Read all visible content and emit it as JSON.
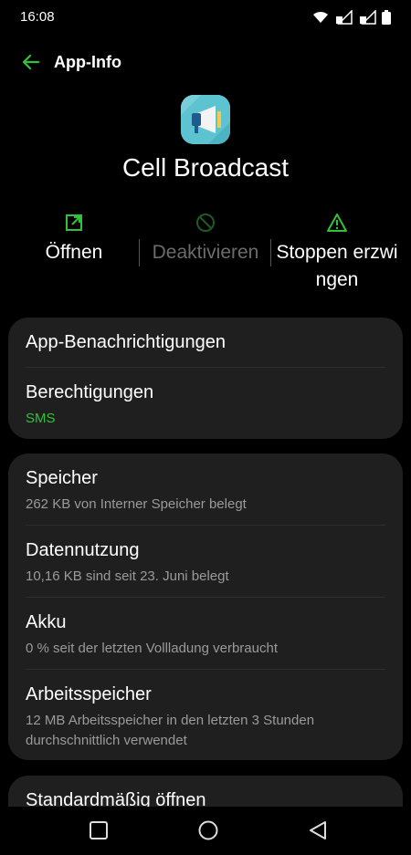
{
  "status": {
    "time": "16:08"
  },
  "appbar": {
    "title": "App-Info"
  },
  "app": {
    "name": "Cell Broadcast"
  },
  "actions": [
    {
      "label": "Öffnen",
      "enabled": true,
      "icon": "open-external-icon"
    },
    {
      "label": "Deaktivieren",
      "enabled": false,
      "icon": "disable-icon"
    },
    {
      "label": "Stoppen erzwingen",
      "enabled": true,
      "icon": "warning-icon"
    }
  ],
  "card1": {
    "notifications": {
      "title": "App-Benachrichtigungen"
    },
    "permissions": {
      "title": "Berechtigungen",
      "subtitle": "SMS"
    }
  },
  "card2": {
    "storage": {
      "title": "Speicher",
      "subtitle": "262 KB von Interner Speicher belegt"
    },
    "data": {
      "title": "Datennutzung",
      "subtitle": "10,16 KB sind seit 23. Juni belegt"
    },
    "battery": {
      "title": "Akku",
      "subtitle": "0 % seit der letzten Vollladung verbraucht"
    },
    "memory": {
      "title": "Arbeitsspeicher",
      "subtitle": "12 MB Arbeitsspeicher in den letzten 3 Stunden durchschnittlich verwendet"
    }
  },
  "card3": {
    "open_default": {
      "title": "Standardmäßig öffnen"
    }
  },
  "colors": {
    "accent": "#31c13b",
    "card": "#1f1f1f",
    "background": "#000000"
  }
}
